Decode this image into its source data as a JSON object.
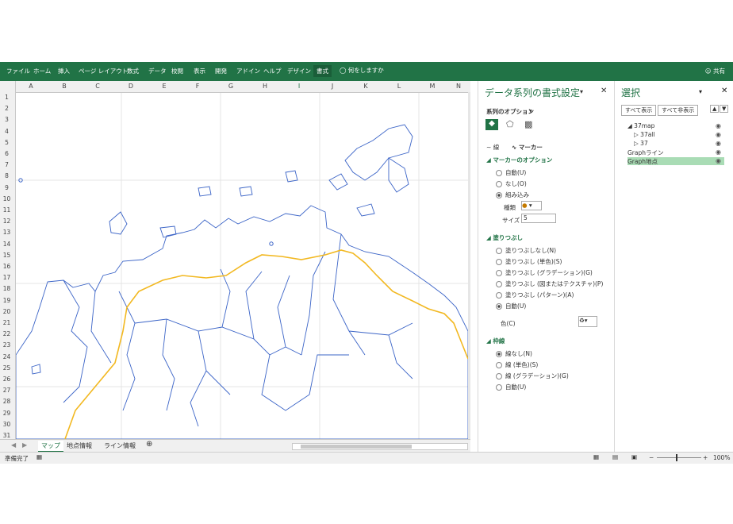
{
  "ribbon": {
    "tabs": [
      "ファイル",
      "ホーム",
      "挿入",
      "ページ レイアウト",
      "数式",
      "データ",
      "校閲",
      "表示",
      "開発",
      "アドイン",
      "ヘルプ",
      "デザイン",
      "書式"
    ],
    "active_tab": "書式",
    "tell_me": "何をしますか",
    "share": "共有",
    "accent": "#217346"
  },
  "sheet": {
    "columns": [
      "A",
      "B",
      "C",
      "D",
      "E",
      "F",
      "G",
      "H",
      "I",
      "J",
      "K",
      "L",
      "M",
      "N"
    ],
    "rows": [
      "1",
      "2",
      "3",
      "4",
      "5",
      "6",
      "7",
      "8",
      "9",
      "10",
      "11",
      "12",
      "13",
      "14",
      "15",
      "16",
      "17",
      "18",
      "19",
      "20",
      "21",
      "22",
      "23",
      "24",
      "25",
      "26",
      "27",
      "28",
      "29",
      "30",
      "31"
    ],
    "tabs": [
      "マップ",
      "地点情報",
      "ライン情報"
    ],
    "active_tab": "マップ",
    "map_outline_color": "#3b64c7",
    "route_color": "#f2b820"
  },
  "status": {
    "text": "準備完了",
    "zoom": "100%"
  },
  "format_pane": {
    "title": "データ系列の書式設定",
    "series_options": "系列のオプション",
    "subtabs": [
      "線",
      "マーカー"
    ],
    "marker_options": {
      "header": "マーカーのオプション",
      "options": [
        "自動(U)",
        "なし(O)",
        "組み込み"
      ],
      "selected": "組み込み",
      "type_label": "種類",
      "size_label": "サイズ",
      "size_value": "5"
    },
    "fill": {
      "header": "塗りつぶし",
      "options": [
        "塗りつぶしなし(N)",
        "塗りつぶし (単色)(S)",
        "塗りつぶし (グラデーション)(G)",
        "塗りつぶし (図またはテクスチャ)(P)",
        "塗りつぶし (パターン)(A)",
        "自動(U)"
      ],
      "selected": "自動(U)",
      "color_label": "色(C)"
    },
    "border": {
      "header": "枠線",
      "options": [
        "線なし(N)",
        "線 (単色)(S)",
        "線 (グラデーション)(G)",
        "自動(U)"
      ],
      "selected": "線なし(N)"
    }
  },
  "selection_pane": {
    "title": "選択",
    "show_all": "すべて表示",
    "hide_all": "すべて非表示",
    "items": [
      {
        "label": "37map",
        "selected": false
      },
      {
        "label": "37all",
        "selected": false
      },
      {
        "label": "37",
        "selected": false
      },
      {
        "label": "Graphライン",
        "selected": false
      },
      {
        "label": "Graph地点",
        "selected": true
      }
    ],
    "selected_color": "#a9dcb5"
  }
}
